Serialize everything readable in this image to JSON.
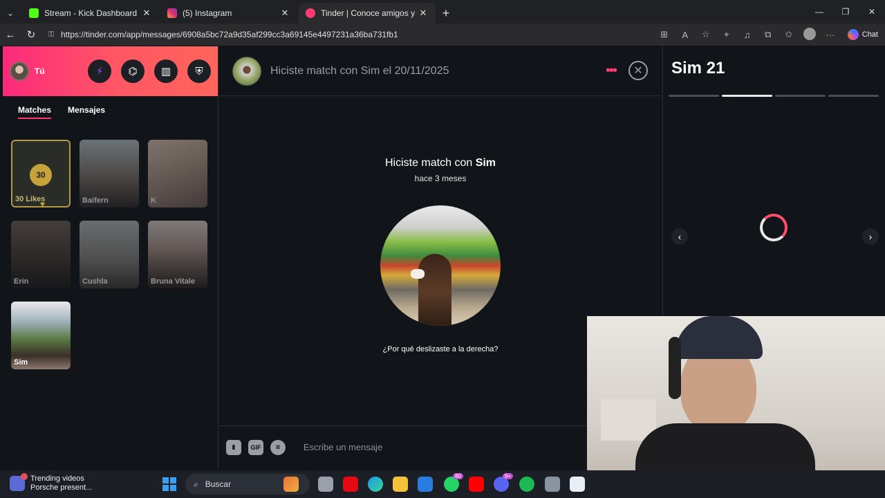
{
  "browser": {
    "tabs": [
      {
        "label": "Stream - Kick Dashboard",
        "favicon_color": "#53fc18"
      },
      {
        "label": "(5) Instagram",
        "favicon_color": "#e1306c"
      },
      {
        "label": "Tinder | Conoce amigos y gente nu",
        "favicon_color": "#fe3c72"
      }
    ],
    "url": "https://tinder.com/app/messages/6908a5bc72a9d35af299cc3a69145e4497231a36ba731fb1",
    "chat_label": "Chat"
  },
  "sidebar": {
    "me_label": "Tú",
    "tabs": [
      "Matches",
      "Mensajes"
    ],
    "likes": {
      "count": "30",
      "label": "30 Likes"
    },
    "matches": [
      "Baifern",
      "K",
      "Erin",
      "Cushla",
      "Bruna Vitale",
      "Sim"
    ]
  },
  "chat": {
    "header": "Hiciste match con Sim el 20/11/2025",
    "match_prefix": "Hiciste match con",
    "match_name": "Sim",
    "match_time": "hace 3 meses",
    "why_link": "¿Por qué deslizaste a la derecha?",
    "gif_label": "GIF",
    "placeholder": "Escribe un mensaje"
  },
  "profile": {
    "name": "Sim 21",
    "photo_count": 4,
    "active_photo": 2
  },
  "taskbar": {
    "trend_title": "Trending videos",
    "trend_sub": "Porsche present...",
    "search_label": "Buscar",
    "badges": {
      "whatsapp": "80",
      "discord": "9+"
    }
  },
  "colors": {
    "brand_gradient_start": "#fd297b",
    "brand_gradient_end": "#ff655b",
    "accent": "#fe3c72",
    "background": "#111418"
  }
}
